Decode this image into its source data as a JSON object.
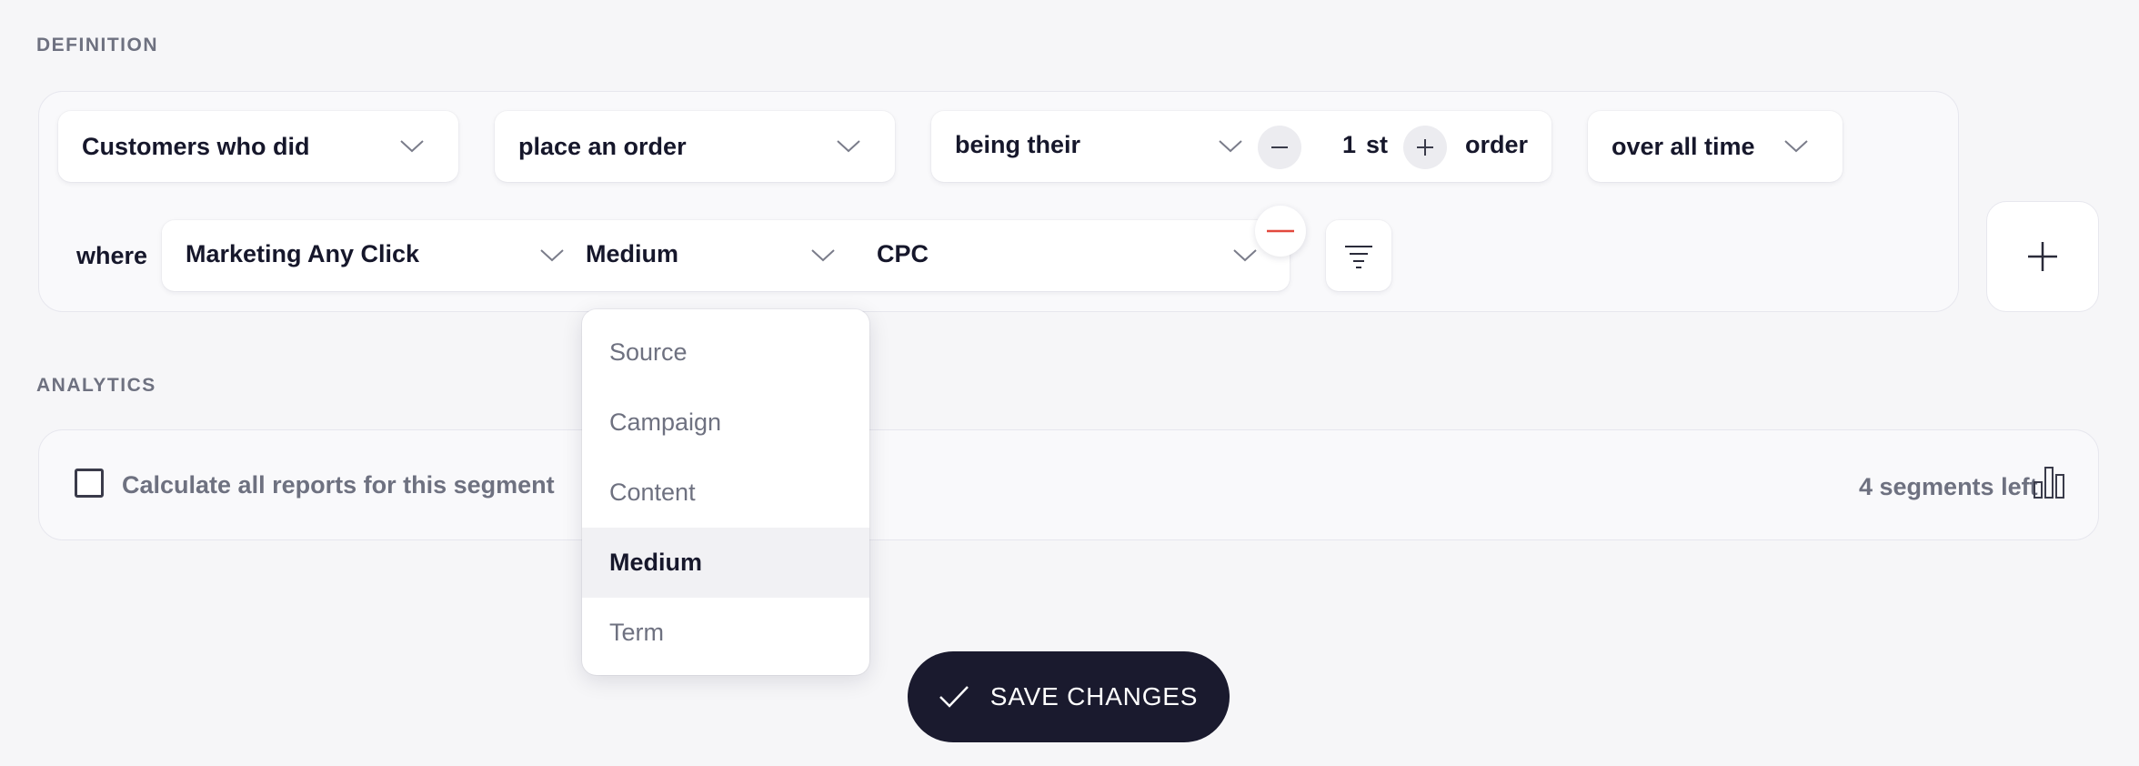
{
  "definition": {
    "section_title": "DEFINITION",
    "row1": {
      "subject": "Customers who did",
      "action": "place an order",
      "ordinal_mode": "being their",
      "ordinal_value": "1",
      "ordinal_suffix": "st",
      "ordinal_unit": "order",
      "timeframe": "over all time"
    },
    "row2": {
      "where_label": "where",
      "attribute": "Marketing Any Click",
      "property": "Medium",
      "value": "CPC"
    },
    "property_dropdown": {
      "options": [
        "Source",
        "Campaign",
        "Content",
        "Medium",
        "Term"
      ],
      "selected": "Medium"
    }
  },
  "analytics": {
    "section_title": "ANALYTICS",
    "checkbox_label": "Calculate all reports for this segment",
    "checkbox_checked": false,
    "segments_left": "4 segments left"
  },
  "save_button": {
    "label": "SAVE CHANGES"
  },
  "colors": {
    "background": "#f6f6f8",
    "save_button": "#1a1a2e",
    "remove_accent": "#e2483d"
  }
}
